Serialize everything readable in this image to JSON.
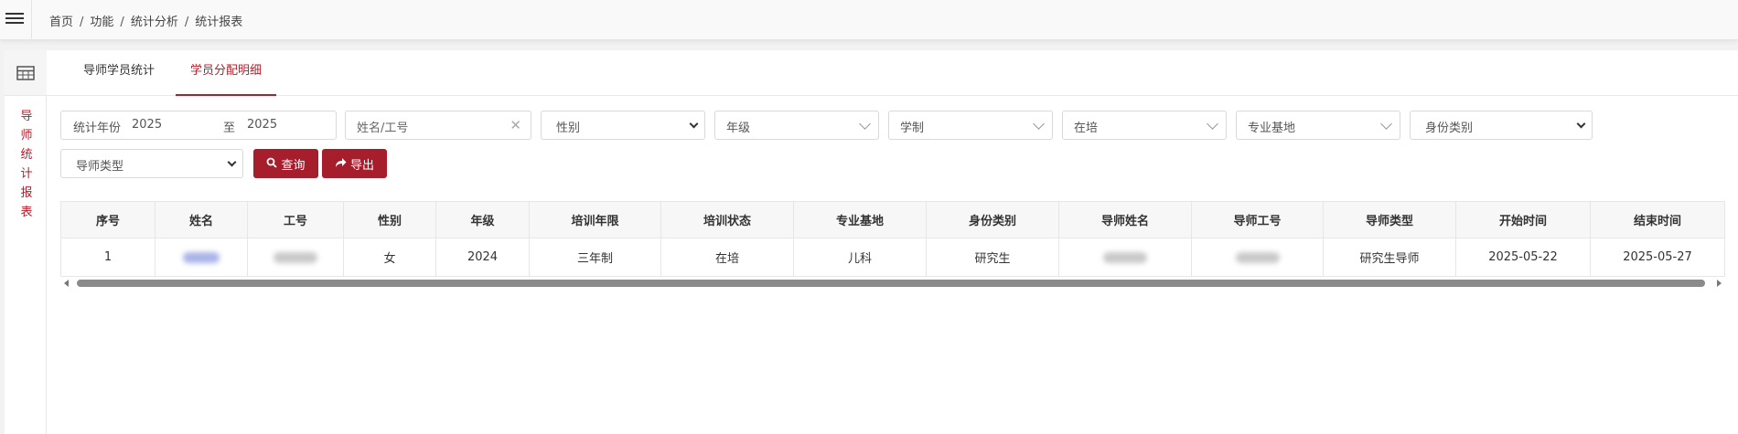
{
  "breadcrumb": [
    "首页",
    "功能",
    "统计分析",
    "统计报表"
  ],
  "side": {
    "title": "导师统计报表",
    "icon": "table-icon"
  },
  "tabs": [
    {
      "label": "导师学员统计",
      "active": false
    },
    {
      "label": "学员分配明细",
      "active": true
    }
  ],
  "filters": {
    "year_label": "统计年份",
    "year_from": "2025",
    "year_to_sep": "至",
    "year_to": "2025",
    "name_placeholder": "姓名/工号",
    "gender": "性别",
    "grade": "年级",
    "program": "学制",
    "status": "在培",
    "base": "专业基地",
    "identity": "身份类别",
    "mentor_type": "导师类型"
  },
  "buttons": {
    "query": "查询",
    "export": "导出"
  },
  "table": {
    "columns": [
      "序号",
      "姓名",
      "工号",
      "性别",
      "年级",
      "培训年限",
      "培训状态",
      "专业基地",
      "身份类别",
      "导师姓名",
      "导师工号",
      "导师类型",
      "开始时间",
      "结束时间"
    ],
    "rows": [
      {
        "index": "1",
        "gender": "女",
        "grade": "2024",
        "years": "三年制",
        "status": "在培",
        "base": "儿科",
        "identity": "研究生",
        "mentor_type": "研究生导师",
        "start": "2025-05-22",
        "end": "2025-05-27"
      }
    ]
  },
  "colors": {
    "accent": "#a61d2b",
    "accent_text": "#b71c2a"
  }
}
